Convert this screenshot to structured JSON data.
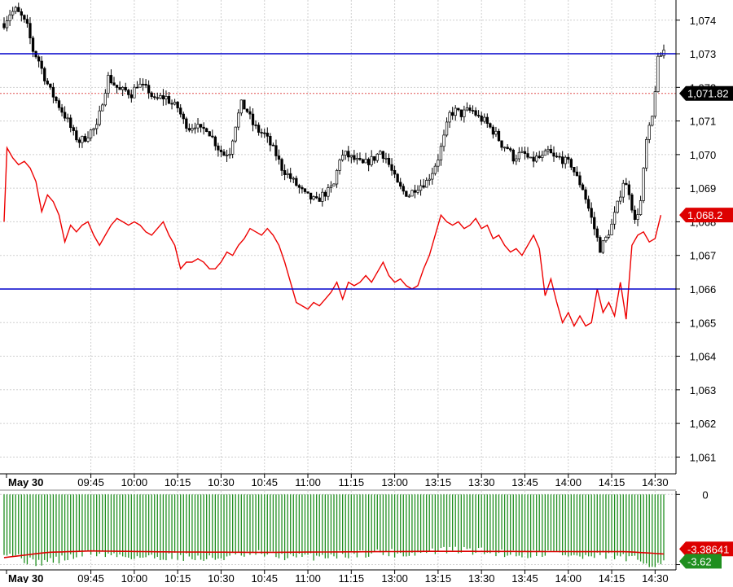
{
  "chart_data": [
    {
      "type": "candlestick",
      "panel": "price",
      "xlabel": "",
      "ylabel": "",
      "ylim": [
        1060.5,
        1074.6
      ],
      "y_ticks": [
        "1,061",
        "1,062",
        "1,063",
        "1,064",
        "1,065",
        "1,066",
        "1,067",
        "1,068",
        "1,069",
        "1,070",
        "1,071",
        "1,072",
        "1,073",
        "1,074"
      ],
      "y_tick_values": [
        1061,
        1062,
        1063,
        1064,
        1065,
        1066,
        1067,
        1068,
        1069,
        1070,
        1071,
        1072,
        1073,
        1074
      ],
      "x_tick_labels": [
        "May 30",
        "09:45",
        "10:00",
        "10:15",
        "10:30",
        "10:45",
        "11:00",
        "11:15",
        "13:00",
        "13:15",
        "13:30",
        "13:45",
        "14:00",
        "14:15",
        "14:30"
      ],
      "x_tick_positions": [
        0,
        30,
        45,
        60,
        75,
        90,
        105,
        120,
        135,
        150,
        165,
        180,
        195,
        210,
        225
      ],
      "grid": true,
      "horizontal_lines": [
        {
          "name": "upper-level",
          "value": 1073.0,
          "color": "#0000cc"
        },
        {
          "name": "lower-level",
          "value": 1066.0,
          "color": "#0000cc"
        }
      ],
      "price_line": {
        "value": 1071.82,
        "label": "1,071.82",
        "color": "#e05050"
      },
      "red_badge": {
        "value": 1068.2,
        "label": "1,068.2",
        "color": "#dd0000"
      },
      "candle_anchors": [
        [
          0,
          1073.9
        ],
        [
          2,
          1074.2
        ],
        [
          4,
          1074.3
        ],
        [
          6,
          1074.1
        ],
        [
          8,
          1073.8
        ],
        [
          10,
          1073.1
        ],
        [
          12,
          1072.8
        ],
        [
          14,
          1072.3
        ],
        [
          16,
          1071.9
        ],
        [
          18,
          1071.6
        ],
        [
          20,
          1071.3
        ],
        [
          22,
          1071.0
        ],
        [
          24,
          1070.6
        ],
        [
          26,
          1070.4
        ],
        [
          28,
          1070.5
        ],
        [
          30,
          1070.7
        ],
        [
          32,
          1070.8
        ],
        [
          34,
          1071.6
        ],
        [
          36,
          1072.3
        ],
        [
          38,
          1072.1
        ],
        [
          40,
          1071.9
        ],
        [
          42,
          1071.9
        ],
        [
          44,
          1071.8
        ],
        [
          46,
          1072.1
        ],
        [
          48,
          1072.0
        ],
        [
          50,
          1071.9
        ],
        [
          52,
          1071.6
        ],
        [
          54,
          1071.7
        ],
        [
          56,
          1071.7
        ],
        [
          58,
          1071.5
        ],
        [
          60,
          1071.4
        ],
        [
          62,
          1071.0
        ],
        [
          64,
          1070.8
        ],
        [
          66,
          1070.9
        ],
        [
          68,
          1070.7
        ],
        [
          70,
          1070.8
        ],
        [
          72,
          1070.5
        ],
        [
          74,
          1070.2
        ],
        [
          76,
          1070.0
        ],
        [
          78,
          1070.1
        ],
        [
          80,
          1070.9
        ],
        [
          82,
          1071.5
        ],
        [
          84,
          1071.3
        ],
        [
          86,
          1070.9
        ],
        [
          88,
          1070.7
        ],
        [
          90,
          1070.6
        ],
        [
          92,
          1070.3
        ],
        [
          94,
          1070.0
        ],
        [
          96,
          1069.6
        ],
        [
          98,
          1069.4
        ],
        [
          100,
          1069.2
        ],
        [
          102,
          1069.0
        ],
        [
          104,
          1068.8
        ],
        [
          106,
          1068.7
        ],
        [
          108,
          1068.6
        ],
        [
          110,
          1068.8
        ],
        [
          112,
          1068.9
        ],
        [
          114,
          1069.1
        ],
        [
          116,
          1069.9
        ],
        [
          118,
          1070.0
        ],
        [
          120,
          1069.9
        ],
        [
          122,
          1069.8
        ],
        [
          124,
          1069.7
        ],
        [
          126,
          1069.8
        ],
        [
          128,
          1069.9
        ],
        [
          130,
          1070.1
        ],
        [
          132,
          1069.9
        ],
        [
          134,
          1069.5
        ],
        [
          136,
          1069.1
        ],
        [
          138,
          1068.9
        ],
        [
          140,
          1068.8
        ],
        [
          142,
          1069.0
        ],
        [
          144,
          1069.1
        ],
        [
          146,
          1069.2
        ],
        [
          148,
          1069.5
        ],
        [
          150,
          1069.9
        ],
        [
          152,
          1070.5
        ],
        [
          154,
          1071.2
        ],
        [
          156,
          1071.3
        ],
        [
          158,
          1071.2
        ],
        [
          160,
          1071.3
        ],
        [
          162,
          1071.3
        ],
        [
          164,
          1071.1
        ],
        [
          166,
          1071.0
        ],
        [
          168,
          1070.8
        ],
        [
          170,
          1070.6
        ],
        [
          172,
          1070.3
        ],
        [
          174,
          1070.2
        ],
        [
          176,
          1069.9
        ],
        [
          178,
          1070.0
        ],
        [
          180,
          1070.0
        ],
        [
          182,
          1069.8
        ],
        [
          184,
          1069.9
        ],
        [
          186,
          1069.9
        ],
        [
          188,
          1070.1
        ],
        [
          190,
          1069.9
        ],
        [
          192,
          1069.9
        ],
        [
          194,
          1069.8
        ],
        [
          196,
          1069.7
        ],
        [
          198,
          1069.3
        ],
        [
          200,
          1069.0
        ],
        [
          202,
          1068.4
        ],
        [
          204,
          1067.8
        ],
        [
          206,
          1067.2
        ],
        [
          208,
          1067.5
        ],
        [
          210,
          1067.9
        ],
        [
          212,
          1068.5
        ],
        [
          214,
          1069.2
        ],
        [
          216,
          1068.9
        ],
        [
          218,
          1068.0
        ],
        [
          220,
          1068.6
        ],
        [
          222,
          1070.4
        ],
        [
          224,
          1071.1
        ],
        [
          226,
          1072.8
        ],
        [
          228,
          1073.1
        ]
      ],
      "red_series": [
        [
          0,
          1068.0
        ],
        [
          1,
          1070.2
        ],
        [
          3,
          1069.9
        ],
        [
          5,
          1069.7
        ],
        [
          7,
          1069.8
        ],
        [
          9,
          1069.6
        ],
        [
          11,
          1069.2
        ],
        [
          13,
          1068.3
        ],
        [
          15,
          1068.8
        ],
        [
          17,
          1068.6
        ],
        [
          19,
          1068.2
        ],
        [
          21,
          1067.4
        ],
        [
          23,
          1067.9
        ],
        [
          25,
          1067.7
        ],
        [
          27,
          1067.9
        ],
        [
          29,
          1068.0
        ],
        [
          31,
          1067.6
        ],
        [
          33,
          1067.3
        ],
        [
          35,
          1067.6
        ],
        [
          37,
          1067.9
        ],
        [
          39,
          1068.1
        ],
        [
          41,
          1068.0
        ],
        [
          43,
          1067.9
        ],
        [
          45,
          1068.0
        ],
        [
          47,
          1067.9
        ],
        [
          49,
          1067.7
        ],
        [
          51,
          1067.6
        ],
        [
          53,
          1067.8
        ],
        [
          55,
          1068.0
        ],
        [
          57,
          1067.6
        ],
        [
          59,
          1067.3
        ],
        [
          61,
          1066.6
        ],
        [
          63,
          1066.8
        ],
        [
          65,
          1066.8
        ],
        [
          67,
          1066.9
        ],
        [
          69,
          1066.8
        ],
        [
          71,
          1066.6
        ],
        [
          73,
          1066.6
        ],
        [
          75,
          1066.8
        ],
        [
          77,
          1067.1
        ],
        [
          79,
          1067.0
        ],
        [
          81,
          1067.3
        ],
        [
          83,
          1067.5
        ],
        [
          85,
          1067.8
        ],
        [
          87,
          1067.7
        ],
        [
          89,
          1067.6
        ],
        [
          91,
          1067.8
        ],
        [
          93,
          1067.6
        ],
        [
          95,
          1067.3
        ],
        [
          97,
          1066.8
        ],
        [
          99,
          1066.2
        ],
        [
          101,
          1065.6
        ],
        [
          103,
          1065.5
        ],
        [
          105,
          1065.4
        ],
        [
          107,
          1065.6
        ],
        [
          109,
          1065.5
        ],
        [
          111,
          1065.7
        ],
        [
          113,
          1065.9
        ],
        [
          115,
          1066.2
        ],
        [
          117,
          1065.7
        ],
        [
          119,
          1066.2
        ],
        [
          121,
          1066.1
        ],
        [
          123,
          1066.2
        ],
        [
          125,
          1066.4
        ],
        [
          127,
          1066.2
        ],
        [
          129,
          1066.5
        ],
        [
          131,
          1066.8
        ],
        [
          133,
          1066.4
        ],
        [
          135,
          1066.2
        ],
        [
          137,
          1066.3
        ],
        [
          139,
          1066.1
        ],
        [
          141,
          1066.0
        ],
        [
          143,
          1066.1
        ],
        [
          145,
          1066.6
        ],
        [
          147,
          1067.0
        ],
        [
          149,
          1067.6
        ],
        [
          151,
          1068.2
        ],
        [
          153,
          1068.0
        ],
        [
          155,
          1067.9
        ],
        [
          157,
          1068.0
        ],
        [
          159,
          1067.8
        ],
        [
          161,
          1067.9
        ],
        [
          163,
          1068.1
        ],
        [
          165,
          1067.8
        ],
        [
          167,
          1067.9
        ],
        [
          169,
          1067.5
        ],
        [
          171,
          1067.6
        ],
        [
          173,
          1067.3
        ],
        [
          175,
          1067.1
        ],
        [
          177,
          1067.2
        ],
        [
          179,
          1067.0
        ],
        [
          181,
          1067.3
        ],
        [
          183,
          1067.6
        ],
        [
          185,
          1067.2
        ],
        [
          187,
          1065.8
        ],
        [
          189,
          1066.3
        ],
        [
          191,
          1065.6
        ],
        [
          193,
          1065.0
        ],
        [
          195,
          1065.3
        ],
        [
          197,
          1064.9
        ],
        [
          199,
          1065.2
        ],
        [
          201,
          1064.9
        ],
        [
          203,
          1065.0
        ],
        [
          205,
          1066.0
        ],
        [
          207,
          1065.3
        ],
        [
          209,
          1065.6
        ],
        [
          211,
          1065.2
        ],
        [
          213,
          1066.2
        ],
        [
          215,
          1065.1
        ],
        [
          217,
          1067.3
        ],
        [
          219,
          1067.6
        ],
        [
          221,
          1067.7
        ],
        [
          223,
          1067.4
        ],
        [
          225,
          1067.5
        ],
        [
          227,
          1068.2
        ]
      ]
    },
    {
      "type": "bar",
      "panel": "oscillator",
      "xlabel": "",
      "ylabel": "",
      "ylim": [
        -4.3,
        0.2
      ],
      "y_ticks": [
        "0",
        "-4"
      ],
      "y_tick_values": [
        0,
        -4
      ],
      "x_tick_labels": [
        "May 30",
        "09:45",
        "10:00",
        "10:15",
        "10:30",
        "10:45",
        "11:00",
        "11:15",
        "13:00",
        "13:15",
        "13:30",
        "13:45",
        "14:00",
        "14:15",
        "14:30"
      ],
      "bar_color": "#1f8f1f",
      "line_color": "#dd0000",
      "badges": [
        {
          "label": "-3.38641",
          "value": -3.38641,
          "color": "#dd0000"
        },
        {
          "label": "-3.62",
          "value": -3.62,
          "color": "#1f8f1f"
        }
      ],
      "bar_anchors": [
        [
          0,
          -3.2
        ],
        [
          10,
          -3.9
        ],
        [
          20,
          -3.7
        ],
        [
          30,
          -3.3
        ],
        [
          40,
          -3.5
        ],
        [
          50,
          -3.6
        ],
        [
          60,
          -3.5
        ],
        [
          70,
          -3.7
        ],
        [
          80,
          -3.5
        ],
        [
          90,
          -3.4
        ],
        [
          100,
          -3.6
        ],
        [
          110,
          -3.5
        ],
        [
          120,
          -3.4
        ],
        [
          130,
          -3.3
        ],
        [
          140,
          -3.4
        ],
        [
          150,
          -3.2
        ],
        [
          160,
          -3.2
        ],
        [
          170,
          -3.3
        ],
        [
          180,
          -3.4
        ],
        [
          190,
          -3.3
        ],
        [
          200,
          -3.6
        ],
        [
          210,
          -3.5
        ],
        [
          220,
          -3.8
        ],
        [
          226,
          -4.0
        ],
        [
          228,
          -3.6
        ]
      ],
      "line_anchors": [
        [
          0,
          -3.6
        ],
        [
          15,
          -3.3
        ],
        [
          30,
          -3.22
        ],
        [
          60,
          -3.28
        ],
        [
          90,
          -3.3
        ],
        [
          120,
          -3.27
        ],
        [
          150,
          -3.24
        ],
        [
          180,
          -3.25
        ],
        [
          200,
          -3.26
        ],
        [
          215,
          -3.26
        ],
        [
          228,
          -3.39
        ]
      ]
    }
  ]
}
